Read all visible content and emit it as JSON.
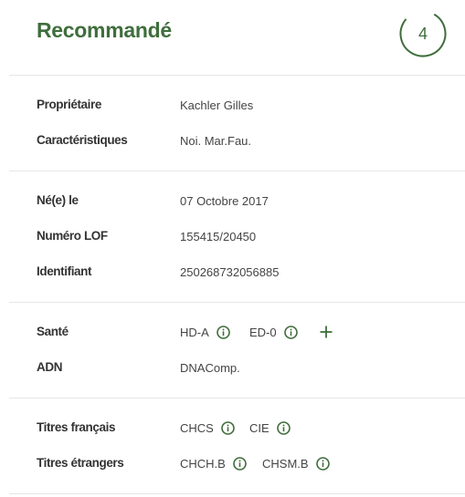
{
  "header": {
    "title": "Recommandé",
    "score": "4"
  },
  "owner_section": {
    "owner": {
      "label": "Propriétaire",
      "value": "Kachler Gilles"
    },
    "features": {
      "label": "Caractéristiques",
      "value": "Noi. Mar.Fau."
    }
  },
  "identity_section": {
    "birth": {
      "label": "Né(e) le",
      "value": "07 Octobre 2017"
    },
    "lof": {
      "label": "Numéro LOF",
      "value": "155415/20450"
    },
    "identifier": {
      "label": "Identifiant",
      "value": "250268732056885"
    }
  },
  "health_section": {
    "health": {
      "label": "Santé",
      "tags": [
        "HD-A",
        "ED-0"
      ]
    },
    "dna": {
      "label": "ADN",
      "value": "DNAComp."
    }
  },
  "titles_section": {
    "french": {
      "label": "Titres français",
      "tags": [
        "CHCS",
        "CIE"
      ]
    },
    "foreign": {
      "label": "Titres étrangers",
      "tags": [
        "CHCH.B",
        "CHSM.B"
      ]
    }
  },
  "icons": {
    "info": "info-circle-icon",
    "expand": "plus-icon"
  },
  "colors": {
    "accent": "#3f6e3c",
    "divider": "#e6e6e6",
    "text": "#333333"
  }
}
